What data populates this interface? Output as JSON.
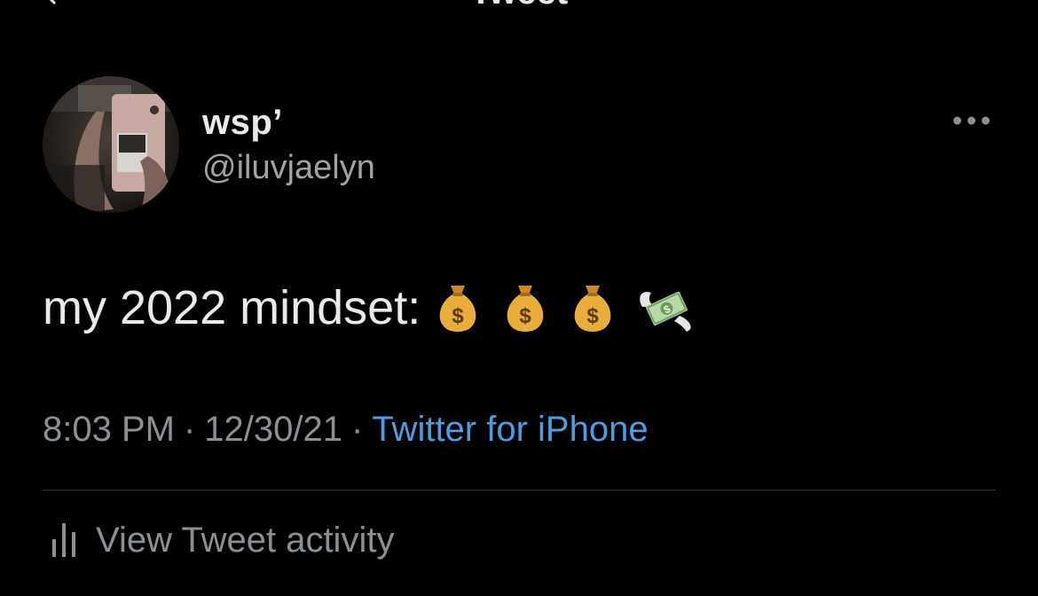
{
  "header": {
    "title": "Tweet"
  },
  "author": {
    "display_name": "wsp’",
    "handle": "@iluvjaelyn"
  },
  "tweet": {
    "text": "my 2022 mindset:",
    "emojis": [
      "money-bag",
      "money-bag",
      "money-bag",
      "money-with-wings"
    ]
  },
  "meta": {
    "time": "8:03 PM",
    "separator": "·",
    "date": "12/30/21",
    "source": "Twitter for iPhone"
  },
  "activity": {
    "label": "View Tweet activity"
  },
  "colors": {
    "background": "#000000",
    "primary_text": "#e7e9ea",
    "secondary_text": "#8b9095",
    "link": "#4d9de0",
    "divider": "#2f3336"
  }
}
